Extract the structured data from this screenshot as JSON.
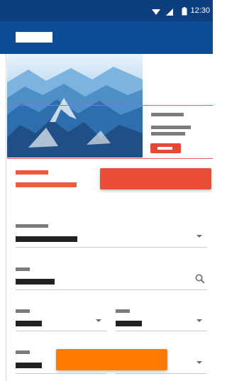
{
  "status_bar": {
    "time": "12:30",
    "icons": [
      "wifi-icon",
      "signal-icon",
      "battery-icon"
    ]
  },
  "app_bar": {
    "title_redacted": true
  },
  "hero_card": {
    "image": "mountain-landscape",
    "button_accent": "#e24a33"
  },
  "actions": {
    "cta_color": "#ea4d38",
    "fab_color": "#ff7a00"
  },
  "form": {
    "search_icon": "search-icon",
    "dropdown_icon": "chevron-down-icon"
  },
  "colors": {
    "status_bar": "#0d3f7e",
    "app_bar": "#0e4c96",
    "accent_red": "#ea4d38",
    "accent_orange": "#ff7a00"
  }
}
